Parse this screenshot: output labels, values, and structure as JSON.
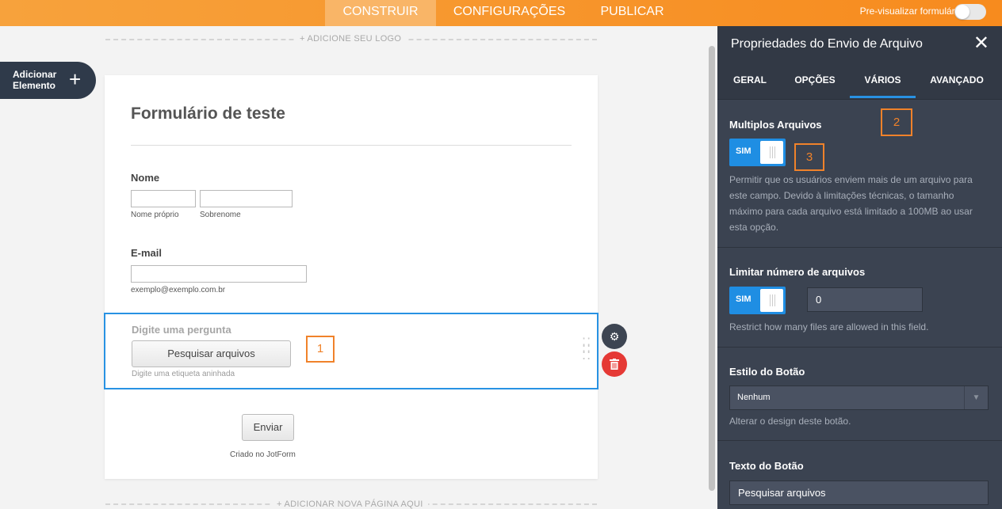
{
  "topbar": {
    "tabs": [
      {
        "label": "CONSTRUIR",
        "active": true
      },
      {
        "label": "CONFIGURAÇÕES",
        "active": false
      },
      {
        "label": "PUBLICAR",
        "active": false
      }
    ],
    "preview_label": "Pre-visualizar formulário",
    "preview_enabled": false
  },
  "canvas": {
    "add_logo": "+ ADICIONE SEU LOGO",
    "add_page": "+ ADICIONAR NOVA PÁGINA AQUI",
    "add_element": {
      "line1": "Adicionar",
      "line2": "Elemento",
      "icon": "plus-icon"
    },
    "form": {
      "title": "Formulário de teste",
      "name_label": "Nome",
      "first_name_sub": "Nome próprio",
      "last_name_sub": "Sobrenome",
      "email_label": "E-mail",
      "email_sub": "exemplo@exemplo.com.br",
      "upload_question": "Digite uma pergunta",
      "upload_button": "Pesquisar arquivos",
      "upload_sub": "Digite uma etiqueta aninhada",
      "submit": "Enviar",
      "created_by": "Criado no JotForm"
    },
    "markers": {
      "m1": "1",
      "m2": "2",
      "m3": "3"
    },
    "field_actions": {
      "settings_icon": "gear-icon",
      "delete_icon": "trash-icon",
      "drag_icon": "drag-handle-icon"
    }
  },
  "panel": {
    "title": "Propriedades do Envio de Arquivo",
    "close_icon": "close-icon",
    "tabs": [
      {
        "label": "GERAL",
        "active": false
      },
      {
        "label": "OPÇÕES",
        "active": false
      },
      {
        "label": "VÁRIOS",
        "active": true
      },
      {
        "label": "AVANÇADO",
        "active": false
      }
    ],
    "multiple": {
      "title": "Multiplos Arquivos",
      "switch_label": "SIM",
      "desc": "Permitir que os usuários enviem mais de um arquivo para este campo. Devido à limitações técnicas, o tamanho máximo para cada arquivo está limitado a 100MB ao usar esta opção."
    },
    "limit": {
      "title": "Limitar número de arquivos",
      "switch_label": "SIM",
      "value": "0",
      "desc": "Restrict how many files are allowed in this field."
    },
    "button_style": {
      "title": "Estilo do Botão",
      "selected": "Nenhum",
      "desc": "Alterar o design deste botão."
    },
    "button_text": {
      "title": "Texto do Botão",
      "value": "Pesquisar arquivos"
    }
  },
  "colors": {
    "accent": "#f78b1e",
    "selection": "#2892e3",
    "panel_bg": "#3b4351",
    "marker": "#f0822a",
    "delete": "#e53935"
  }
}
